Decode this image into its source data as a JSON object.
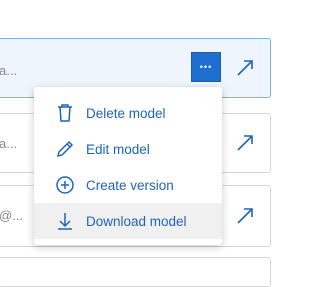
{
  "rows": [
    {
      "snippet": "a...",
      "active": true
    },
    {
      "snippet": "a...",
      "active": false
    },
    {
      "snippet": "@...",
      "active": false
    }
  ],
  "more_button_glyph": "•••",
  "menu": {
    "items": [
      {
        "label": "Delete model",
        "icon": "trash-icon"
      },
      {
        "label": "Edit model",
        "icon": "pencil-icon"
      },
      {
        "label": "Create version",
        "icon": "plus-circle-icon"
      },
      {
        "label": "Download model",
        "icon": "download-icon",
        "highlighted": true
      }
    ]
  },
  "colors": {
    "accent": "#1f6fd1",
    "link": "#1f64b8",
    "active_row_bg": "#eef5fd"
  }
}
